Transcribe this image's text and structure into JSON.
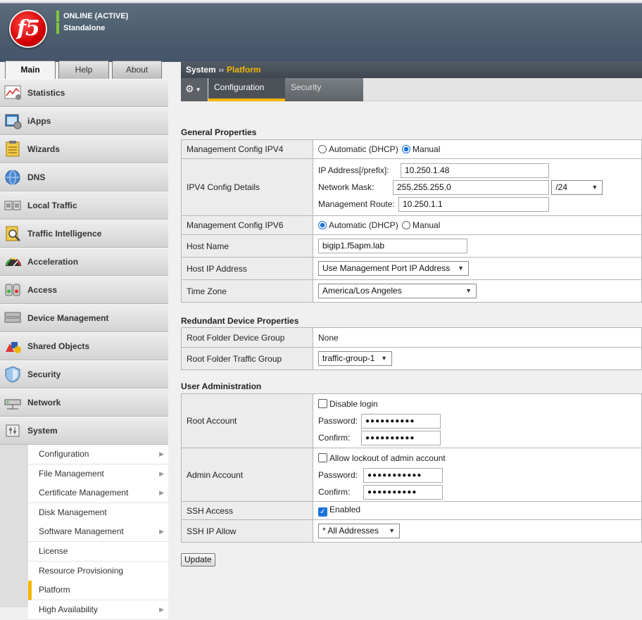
{
  "header": {
    "logo_text": "f5",
    "status_primary": "ONLINE (ACTIVE)",
    "status_secondary": "Standalone",
    "status_color": "#7ec838"
  },
  "top_tabs": [
    "Main",
    "Help",
    "About"
  ],
  "sidebar": {
    "items": [
      {
        "label": "Statistics",
        "icon": "statistics-icon"
      },
      {
        "label": "iApps",
        "icon": "iapps-icon"
      },
      {
        "label": "Wizards",
        "icon": "wizards-icon"
      },
      {
        "label": "DNS",
        "icon": "dns-globe-icon"
      },
      {
        "label": "Local Traffic",
        "icon": "local-traffic-icon"
      },
      {
        "label": "Traffic Intelligence",
        "icon": "traffic-intelligence-icon"
      },
      {
        "label": "Acceleration",
        "icon": "acceleration-gauge-icon"
      },
      {
        "label": "Access",
        "icon": "access-icon"
      },
      {
        "label": "Device Management",
        "icon": "device-management-icon"
      },
      {
        "label": "Shared Objects",
        "icon": "shared-objects-icon"
      },
      {
        "label": "Security",
        "icon": "security-shield-icon"
      },
      {
        "label": "Network",
        "icon": "network-icon"
      },
      {
        "label": "System",
        "icon": "system-icon"
      }
    ],
    "system_submenu": [
      {
        "label": "Configuration",
        "has_children": true
      },
      {
        "label": "File Management",
        "has_children": true
      },
      {
        "label": "Certificate Management",
        "has_children": true
      },
      {
        "label": "Disk Management",
        "has_children": false
      },
      {
        "label": "Software Management",
        "has_children": true
      },
      {
        "label": "License",
        "has_children": false
      },
      {
        "label": "Resource Provisioning",
        "has_children": false
      },
      {
        "label": "Platform",
        "has_children": false,
        "active": true
      },
      {
        "label": "High Availability",
        "has_children": true
      }
    ]
  },
  "breadcrumb": {
    "root": "System",
    "separator": "››",
    "current": "Platform"
  },
  "subtabs": [
    "Configuration",
    "Security"
  ],
  "general": {
    "title": "General Properties",
    "mgmt_ipv4_label": "Management Config IPV4",
    "opt_auto": "Automatic (DHCP)",
    "opt_manual": "Manual",
    "ipv4_details_label": "IPV4 Config Details",
    "ip_label": "IP Address[/prefix]:",
    "ip_value": "10.250.1.48",
    "mask_label": "Network Mask:",
    "mask_value": "255.255.255.0",
    "prefix_value": "/24",
    "route_label": "Management Route:",
    "route_value": "10.250.1.1",
    "mgmt_ipv6_label": "Management Config IPV6",
    "hostname_label": "Host Name",
    "hostname_value": "bigip1.f5apm.lab",
    "hostip_label": "Host IP Address",
    "hostip_value": "Use Management Port IP Address",
    "timezone_label": "Time Zone",
    "timezone_value": "America/Los Angeles"
  },
  "redundant": {
    "title": "Redundant Device Properties",
    "device_group_label": "Root Folder Device Group",
    "device_group_value": "None",
    "traffic_group_label": "Root Folder Traffic Group",
    "traffic_group_value": "traffic-group-1"
  },
  "useradmin": {
    "title": "User Administration",
    "root_label": "Root Account",
    "disable_login": "Disable login",
    "password_label": "Password:",
    "confirm_label": "Confirm:",
    "masked": "●●●●●●●●●●",
    "masked_admin": "●●●●●●●●●●●",
    "admin_label": "Admin Account",
    "allow_lockout": "Allow lockout of admin account",
    "ssh_label": "SSH Access",
    "ssh_enabled": "Enabled",
    "ssh_ip_label": "SSH IP Allow",
    "ssh_ip_value": "* All Addresses"
  },
  "update_button": "Update"
}
